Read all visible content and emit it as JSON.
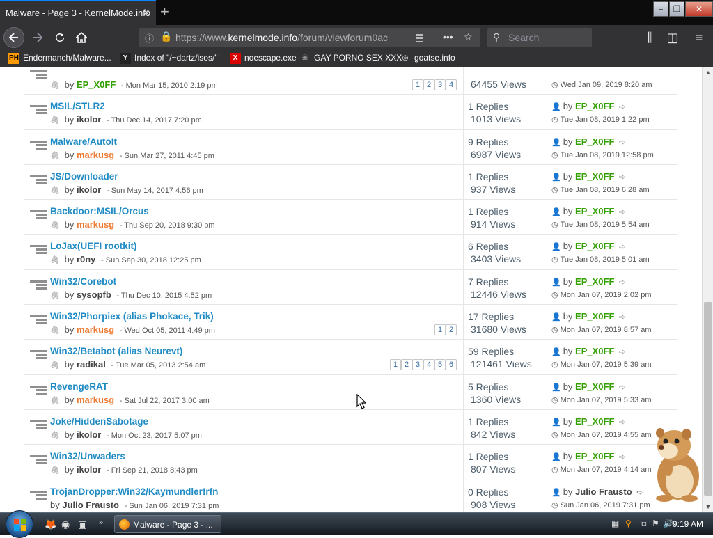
{
  "browser": {
    "tab_title": "Malware - Page 3 - KernelMode.info",
    "tab_close": "✕",
    "new_tab": "+",
    "url_host": "https://www.",
    "url_domain": "kernelmode.info",
    "url_path": "/forum/viewforum0ac",
    "search_placeholder": "Search",
    "window_controls": {
      "minimize": "–",
      "maximize": "❐",
      "close": "✕"
    },
    "bookmarks": [
      {
        "icon": "PH",
        "label": "Endermanch/Malware..."
      },
      {
        "icon": "Y",
        "label": "Index of \"/~dartz/isos/\""
      },
      {
        "icon": "X",
        "label": "noescape.exe"
      },
      {
        "icon": "☠",
        "label": "GAY PORNO SEX XXX"
      },
      {
        "icon": "◎",
        "label": "goatse.info"
      }
    ]
  },
  "colors": {
    "title_link": "#1f8bc4",
    "author_green": "#32a000",
    "author_orange": "#ee7b33",
    "author_plain": "#444444"
  },
  "topics": [
    {
      "title": "",
      "author": "EP_X0FF",
      "author_color": "green",
      "date": "- Mon Mar 15, 2010 2:19 pm",
      "pages": [
        "1",
        "2",
        "3",
        "4"
      ],
      "replies": "",
      "views": "64455 Views",
      "last_by": "",
      "last_by_color": "plain",
      "last_time": "Wed Jan 09, 2019 8:20 am"
    },
    {
      "title": "MSIL/STLR2",
      "author": "ikolor",
      "author_color": "plain",
      "date": "- Thu Dec 14, 2017 7:20 pm",
      "pages": [],
      "replies": "1 Replies",
      "views": "1013 Views",
      "last_by": "EP_X0FF",
      "last_by_color": "green",
      "last_time": "Tue Jan 08, 2019 1:22 pm"
    },
    {
      "title": "Malware/AutoIt",
      "author": "markusg",
      "author_color": "orange",
      "date": "- Sun Mar 27, 2011 4:45 pm",
      "pages": [],
      "replies": "9 Replies",
      "views": "6987 Views",
      "last_by": "EP_X0FF",
      "last_by_color": "green",
      "last_time": "Tue Jan 08, 2019 12:58 pm"
    },
    {
      "title": "JS/Downloader",
      "author": "ikolor",
      "author_color": "plain",
      "date": "- Sun May 14, 2017 4:56 pm",
      "pages": [],
      "replies": "1 Replies",
      "views": "937 Views",
      "last_by": "EP_X0FF",
      "last_by_color": "green",
      "last_time": "Tue Jan 08, 2019 6:28 am"
    },
    {
      "title": "Backdoor:MSIL/Orcus",
      "author": "markusg",
      "author_color": "orange",
      "date": "- Thu Sep 20, 2018 9:30 pm",
      "pages": [],
      "replies": "1 Replies",
      "views": "914 Views",
      "last_by": "EP_X0FF",
      "last_by_color": "green",
      "last_time": "Tue Jan 08, 2019 5:54 am"
    },
    {
      "title": "LoJax(UEFI rootkit)",
      "author": "r0ny",
      "author_color": "plain",
      "date": "- Sun Sep 30, 2018 12:25 pm",
      "pages": [],
      "replies": "6 Replies",
      "views": "3403 Views",
      "last_by": "EP_X0FF",
      "last_by_color": "green",
      "last_time": "Tue Jan 08, 2019 5:01 am"
    },
    {
      "title": "Win32/Corebot",
      "author": "sysopfb",
      "author_color": "plain",
      "date": "- Thu Dec 10, 2015 4:52 pm",
      "pages": [],
      "replies": "7 Replies",
      "views": "12446 Views",
      "last_by": "EP_X0FF",
      "last_by_color": "green",
      "last_time": "Mon Jan 07, 2019 2:02 pm"
    },
    {
      "title": "Win32/Phorpiex (alias Phokace, Trik)",
      "author": "markusg",
      "author_color": "orange",
      "date": "- Wed Oct 05, 2011 4:49 pm",
      "pages": [
        "1",
        "2"
      ],
      "replies": "17 Replies",
      "views": "31680 Views",
      "last_by": "EP_X0FF",
      "last_by_color": "green",
      "last_time": "Mon Jan 07, 2019 8:57 am"
    },
    {
      "title": "Win32/Betabot (alias Neurevt)",
      "author": "radikal",
      "author_color": "plain",
      "date": "- Tue Mar 05, 2013 2:54 am",
      "pages": [
        "1",
        "2",
        "3",
        "4",
        "5",
        "6"
      ],
      "replies": "59 Replies",
      "views": "121461 Views",
      "last_by": "EP_X0FF",
      "last_by_color": "green",
      "last_time": "Mon Jan 07, 2019 5:39 am"
    },
    {
      "title": "RevengeRAT",
      "author": "markusg",
      "author_color": "orange",
      "date": "- Sat Jul 22, 2017 3:00 am",
      "pages": [],
      "replies": "5 Replies",
      "views": "1360 Views",
      "last_by": "EP_X0FF",
      "last_by_color": "green",
      "last_time": "Mon Jan 07, 2019 5:33 am"
    },
    {
      "title": "Joke/HiddenSabotage",
      "author": "ikolor",
      "author_color": "plain",
      "date": "- Mon Oct 23, 2017 5:07 pm",
      "pages": [],
      "replies": "1 Replies",
      "views": "842 Views",
      "last_by": "EP_X0FF",
      "last_by_color": "green",
      "last_time": "Mon Jan 07, 2019 4:55 am"
    },
    {
      "title": "Win32/Unwaders",
      "author": "ikolor",
      "author_color": "plain",
      "date": "- Fri Sep 21, 2018 8:43 pm",
      "pages": [],
      "replies": "1 Replies",
      "views": "807 Views",
      "last_by": "EP_X0FF",
      "last_by_color": "green",
      "last_time": "Mon Jan 07, 2019 4:14 am"
    },
    {
      "title": "TrojanDropper:Win32/Kaymundler!rfn",
      "author": "Julio Frausto",
      "author_color": "plain",
      "date": "- Sun Jan 06, 2019 7:31 pm",
      "pages": [],
      "replies": "0 Replies",
      "views": "908 Views",
      "last_by": "Julio Frausto",
      "last_by_color": "plain",
      "last_time": "Sun Jan 06, 2019 7:31 pm"
    }
  ],
  "taskbar": {
    "window_button": "Malware - Page 3 - ...",
    "clock": "9:19 AM"
  }
}
